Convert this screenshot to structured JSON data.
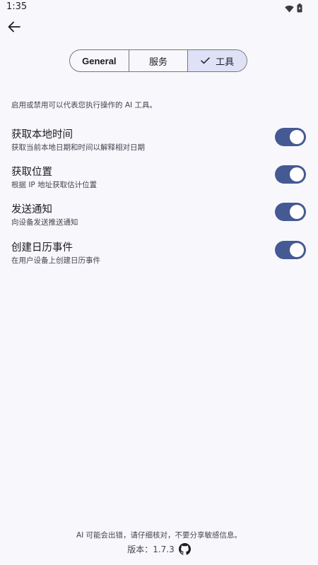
{
  "status_bar": {
    "time": "1:35"
  },
  "segments": [
    {
      "label": "General",
      "selected": false
    },
    {
      "label": "服务",
      "selected": false
    },
    {
      "label": "工具",
      "selected": true
    }
  ],
  "intro": "启用或禁用可以代表您执行操作的 AI 工具。",
  "tools": [
    {
      "title": "获取本地时间",
      "subtitle": "获取当前本地日期和时间以解释相对日期",
      "enabled": true
    },
    {
      "title": "获取位置",
      "subtitle": "根据 IP 地址获取估计位置",
      "enabled": true
    },
    {
      "title": "发送通知",
      "subtitle": "向设备发送推送通知",
      "enabled": true
    },
    {
      "title": "创建日历事件",
      "subtitle": "在用户设备上创建日历事件",
      "enabled": true
    }
  ],
  "footer": {
    "disclaimer": "AI 可能会出错，请仔细核对，不要分享敏感信息。",
    "version": "版本：1.7.3"
  },
  "colors": {
    "accent": "#455a93",
    "selected_segment": "#dfe1f7",
    "background": "#f8f7fc"
  },
  "icons": {
    "back": "arrow-left-icon",
    "check": "check-icon",
    "github": "github-icon",
    "wifi": "wifi-icon",
    "battery": "battery-icon"
  }
}
